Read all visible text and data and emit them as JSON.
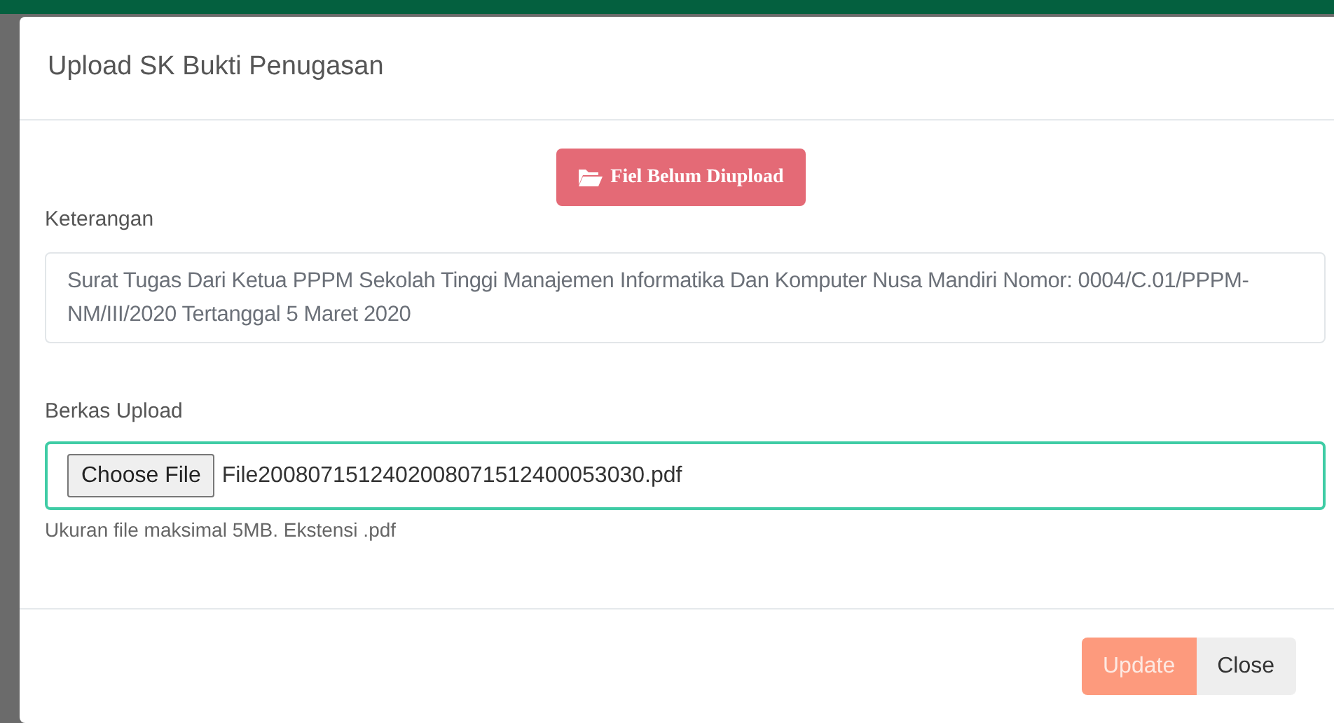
{
  "modal": {
    "title": "Upload SK Bukti Penugasan"
  },
  "status_button": {
    "label": "Fiel Belum Diupload"
  },
  "keterangan": {
    "label": "Keterangan",
    "value": "Surat Tugas Dari Ketua PPPM Sekolah Tinggi Manajemen Informatika Dan Komputer Nusa Mandiri Nomor: 0004/C.01/PPPM-NM/III/2020 Tertanggal 5 Maret 2020"
  },
  "berkas": {
    "label": "Berkas Upload",
    "button": "Choose File",
    "file_name": "File2008071512402008071512400053030.pdf",
    "help": "Ukuran file maksimal 5MB. Ekstensi .pdf"
  },
  "footer_buttons": [
    {
      "kind": "primary",
      "label": "Update",
      "disabled": true
    },
    {
      "kind": "secondary",
      "label": "Close",
      "disabled": false
    }
  ]
}
